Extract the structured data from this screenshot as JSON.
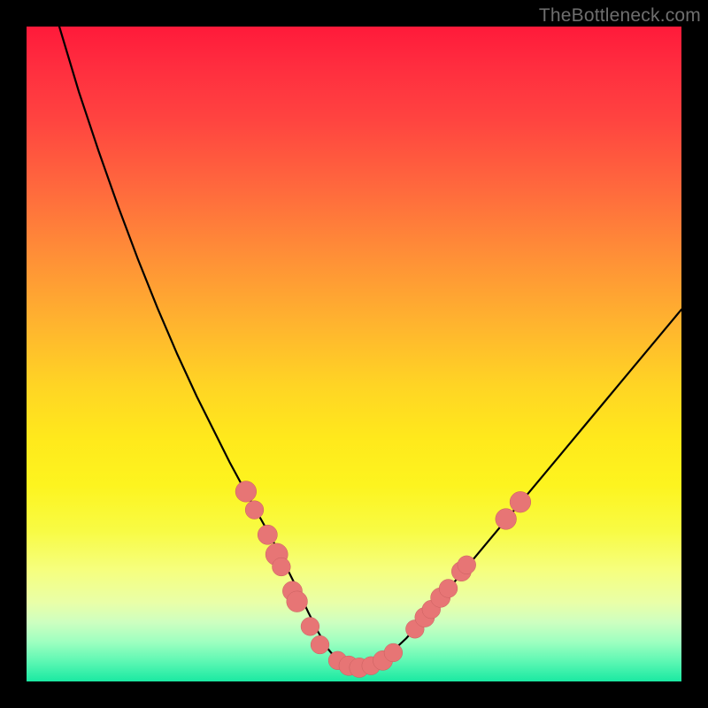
{
  "watermark": "TheBottleneck.com",
  "colors": {
    "curve": "#000000",
    "dot_fill": "#e77575",
    "dot_stroke": "#c95f5f",
    "gradient_top": "#ff1a3a",
    "gradient_bottom": "#1ae9a2"
  },
  "chart_data": {
    "type": "line",
    "title": "",
    "xlabel": "",
    "ylabel": "",
    "xlim": [
      0,
      100
    ],
    "ylim": [
      0,
      100
    ],
    "grid": false,
    "legend": false,
    "series": [
      {
        "name": "curve",
        "x": [
          5,
          8,
          11,
          14,
          17,
          20,
          23,
          26,
          29,
          31,
          33,
          35,
          37,
          38.5,
          40,
          41.5,
          43,
          44.5,
          46,
          47.5,
          49,
          50.5,
          52,
          55,
          58,
          61,
          64,
          67,
          70,
          73,
          76,
          79,
          82,
          85,
          88,
          91,
          94,
          97,
          100
        ],
        "y": [
          100,
          90,
          81,
          72.5,
          64.5,
          57,
          50,
          43.5,
          37.5,
          33.5,
          29.8,
          26.2,
          22.6,
          19.8,
          16.8,
          13.8,
          10.6,
          7.6,
          5.0,
          3.2,
          2.3,
          2.0,
          2.2,
          3.8,
          6.6,
          10.0,
          13.6,
          17.2,
          20.8,
          24.4,
          28.0,
          31.6,
          35.2,
          38.8,
          42.4,
          46.0,
          49.6,
          53.2,
          56.8
        ]
      }
    ],
    "scatter": [
      {
        "name": "dots",
        "points": [
          {
            "x": 33.5,
            "y": 29.0,
            "r": 1.6
          },
          {
            "x": 34.8,
            "y": 26.2,
            "r": 1.4
          },
          {
            "x": 36.8,
            "y": 22.4,
            "r": 1.5
          },
          {
            "x": 38.2,
            "y": 19.4,
            "r": 1.7
          },
          {
            "x": 38.9,
            "y": 17.5,
            "r": 1.4
          },
          {
            "x": 40.6,
            "y": 13.8,
            "r": 1.5
          },
          {
            "x": 41.3,
            "y": 12.2,
            "r": 1.6
          },
          {
            "x": 43.3,
            "y": 8.4,
            "r": 1.4
          },
          {
            "x": 44.8,
            "y": 5.6,
            "r": 1.4
          },
          {
            "x": 47.5,
            "y": 3.2,
            "r": 1.4
          },
          {
            "x": 49.2,
            "y": 2.4,
            "r": 1.5
          },
          {
            "x": 50.8,
            "y": 2.1,
            "r": 1.5
          },
          {
            "x": 52.6,
            "y": 2.4,
            "r": 1.4
          },
          {
            "x": 54.4,
            "y": 3.2,
            "r": 1.5
          },
          {
            "x": 56.0,
            "y": 4.4,
            "r": 1.4
          },
          {
            "x": 59.3,
            "y": 8.0,
            "r": 1.4
          },
          {
            "x": 60.8,
            "y": 9.8,
            "r": 1.5
          },
          {
            "x": 61.8,
            "y": 11.0,
            "r": 1.4
          },
          {
            "x": 63.2,
            "y": 12.8,
            "r": 1.5
          },
          {
            "x": 64.4,
            "y": 14.2,
            "r": 1.4
          },
          {
            "x": 66.4,
            "y": 16.8,
            "r": 1.5
          },
          {
            "x": 67.2,
            "y": 17.8,
            "r": 1.4
          },
          {
            "x": 73.2,
            "y": 24.8,
            "r": 1.6
          },
          {
            "x": 75.4,
            "y": 27.4,
            "r": 1.6
          }
        ]
      }
    ]
  }
}
